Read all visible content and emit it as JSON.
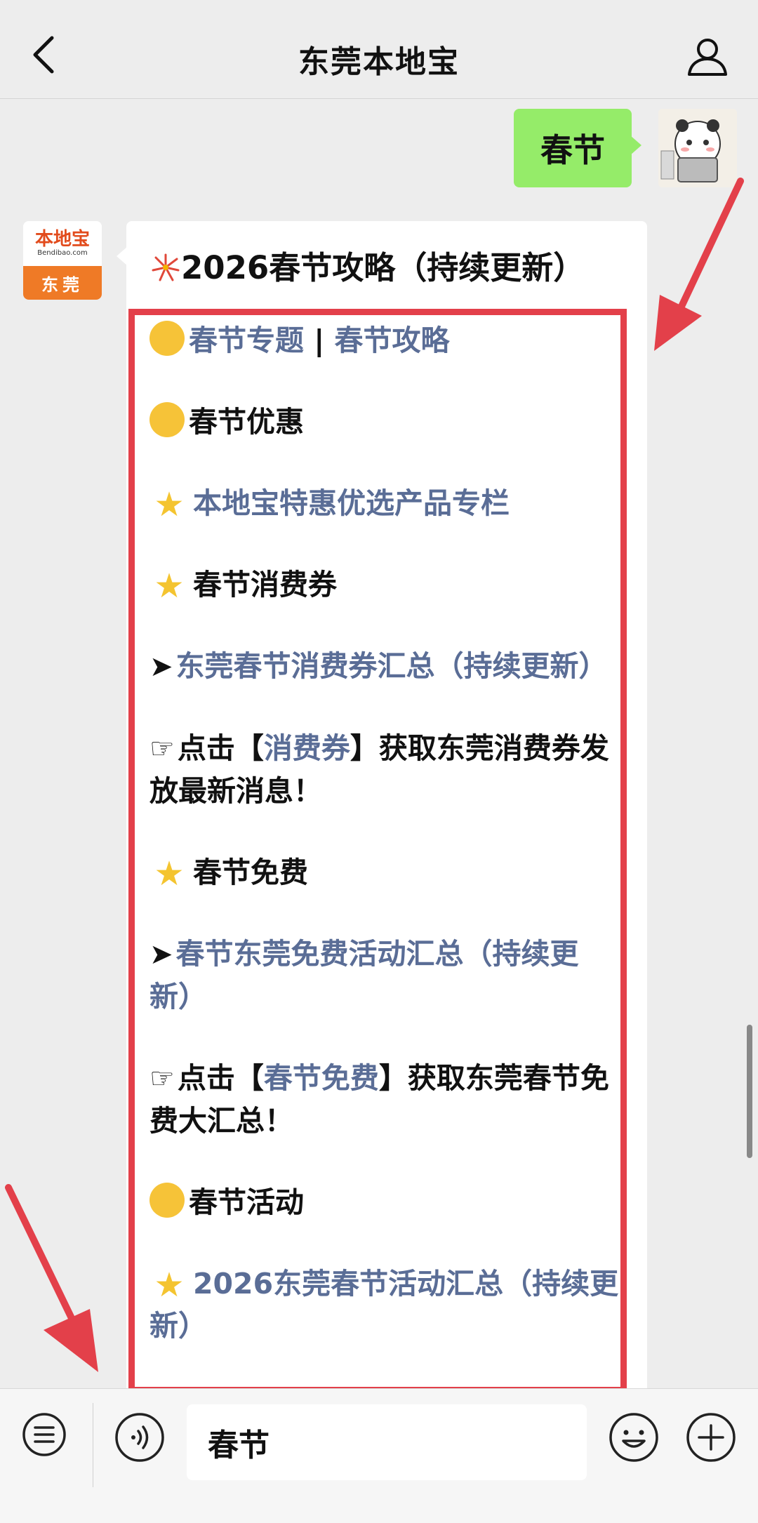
{
  "header": {
    "title": "东莞本地宝"
  },
  "outgoing": {
    "text": "春节"
  },
  "bot": {
    "brand": "本地宝",
    "site": "Bendibao.com",
    "city": "东莞"
  },
  "card": {
    "title": "2026春节攻略（持续更新）"
  },
  "items": {
    "topic_link": "春节专题",
    "separator": "|",
    "guide_link": "春节攻略",
    "deals_heading": "春节优惠",
    "products_link": "本地宝特惠优选产品专栏",
    "vouchers_heading": "春节消费券",
    "vouchers_link": "东莞春节消费券汇总（持续更新）",
    "click_prefix": "点击【",
    "vouchers_keyword": "消费券",
    "vouchers_suffix": "】获取东莞消费券发放最新消息！",
    "free_heading": "春节免费",
    "free_link": "春节东莞免费活动汇总（持续更新）",
    "free_prefix": "点击【",
    "free_keyword": "春节免费",
    "free_suffix": "】获取东莞春节免费大汇总！",
    "activity_heading": "春节活动",
    "activity_link": "2026东莞春节活动汇总（持续更新）"
  },
  "input": {
    "value": "春节"
  },
  "colors": {
    "accent_red": "#e3404a",
    "link": "#5a6d96",
    "bubble_green": "#95ec69"
  }
}
